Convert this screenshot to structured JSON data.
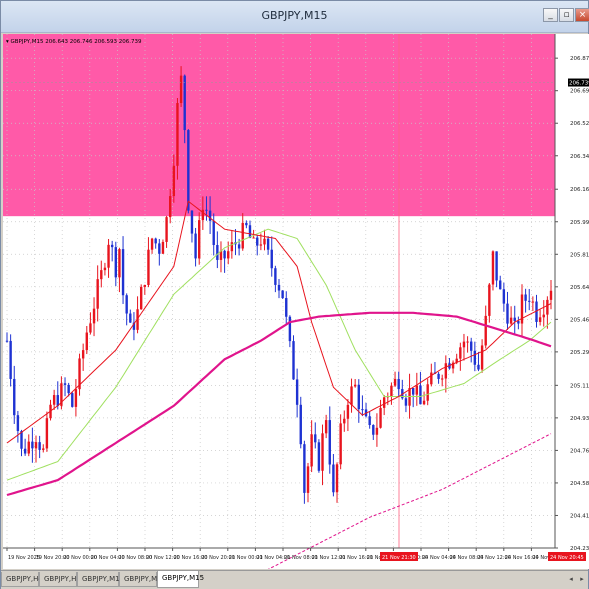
{
  "window": {
    "title": "GBPJPY,M15"
  },
  "info_line": "GBPJPY,M15  206.643 206.746 206.593 206.739",
  "current_price": "206.739",
  "price_axis": [
    "206.870",
    "206.695",
    "206.520",
    "206.345",
    "206.165",
    "205.990",
    "205.815",
    "205.640",
    "205.465",
    "205.290",
    "205.110",
    "204.935",
    "204.760",
    "204.585",
    "204.410",
    "204.235"
  ],
  "time_axis": [
    "19 Nov 2025",
    "19 Nov 20:00",
    "20 Nov 00:00",
    "20 Nov 04:00",
    "20 Nov 08:00",
    "20 Nov 12:00",
    "20 Nov 16:00",
    "20 Nov 20:00",
    "21 Nov 00:00",
    "21 Nov 04:00",
    "21 Nov 08:00",
    "21 Nov 12:00",
    "21 Nov 16:00",
    "21 Nov 20:00",
    "24 Nov 00:00",
    "24 Nov 04:00",
    "24 Nov 08:00",
    "24 Nov 12:00",
    "24 Nov 16:00",
    "24 Nov 20:00"
  ],
  "crosshair_time": "21 Nov 21:30",
  "cursor_time": "24 Nov 20:45",
  "tabs": [
    "GBPJPY,H4",
    "GBPJPY,H1",
    "GBPJPY,M15",
    "GBPJPY,M5",
    "GBPJPY,M15"
  ],
  "active_tab": 4,
  "colors": {
    "zone": "#ff5aa8",
    "bull": "#e8141e",
    "bear": "#1e32d2",
    "ma_red": "#e8141e",
    "ma_green": "#a0e060",
    "ma_magenta": "#e0148c"
  },
  "chart_data": {
    "type": "candlestick",
    "symbol": "GBPJPY",
    "timeframe": "M15",
    "ylim": [
      204.235,
      207.0
    ],
    "zone": [
      206.02,
      207.0
    ],
    "close_path": [
      [
        0,
        205.35
      ],
      [
        2,
        205.0
      ],
      [
        4,
        204.75
      ],
      [
        6,
        204.8
      ],
      [
        8,
        204.85
      ],
      [
        10,
        204.75
      ],
      [
        12,
        205.0
      ],
      [
        14,
        205.05
      ],
      [
        16,
        205.1
      ],
      [
        18,
        205.0
      ],
      [
        20,
        205.2
      ],
      [
        22,
        205.4
      ],
      [
        24,
        205.55
      ],
      [
        26,
        205.7
      ],
      [
        28,
        205.9
      ],
      [
        30,
        205.75
      ],
      [
        31,
        205.85
      ],
      [
        32,
        205.6
      ],
      [
        34,
        205.4
      ],
      [
        36,
        205.5
      ],
      [
        38,
        205.7
      ],
      [
        40,
        205.9
      ],
      [
        42,
        205.85
      ],
      [
        44,
        206.0
      ],
      [
        46,
        206.35
      ],
      [
        47,
        206.6
      ],
      [
        48,
        206.75
      ],
      [
        49,
        206.5
      ],
      [
        50,
        206.1
      ],
      [
        52,
        205.8
      ],
      [
        54,
        206.1
      ],
      [
        56,
        206.0
      ],
      [
        58,
        205.75
      ],
      [
        60,
        205.8
      ],
      [
        62,
        205.85
      ],
      [
        64,
        205.9
      ],
      [
        66,
        205.95
      ],
      [
        68,
        205.85
      ],
      [
        70,
        205.9
      ],
      [
        72,
        205.8
      ],
      [
        74,
        205.7
      ],
      [
        76,
        205.6
      ],
      [
        78,
        205.3
      ],
      [
        80,
        205.05
      ],
      [
        81,
        204.85
      ],
      [
        82,
        204.55
      ],
      [
        84,
        204.8
      ],
      [
        86,
        204.7
      ],
      [
        88,
        204.95
      ],
      [
        90,
        204.5
      ],
      [
        92,
        204.85
      ],
      [
        94,
        205.05
      ],
      [
        96,
        205.1
      ],
      [
        98,
        204.95
      ],
      [
        100,
        204.85
      ],
      [
        102,
        204.9
      ],
      [
        104,
        205.05
      ],
      [
        106,
        205.1
      ],
      [
        108,
        205.15
      ],
      [
        110,
        205.05
      ],
      [
        112,
        205.1
      ],
      [
        114,
        205.0
      ],
      [
        116,
        205.1
      ],
      [
        118,
        205.15
      ],
      [
        120,
        205.2
      ],
      [
        122,
        205.25
      ],
      [
        124,
        205.3
      ],
      [
        126,
        205.35
      ],
      [
        128,
        205.3
      ],
      [
        130,
        205.2
      ],
      [
        132,
        205.45
      ],
      [
        134,
        205.8
      ],
      [
        136,
        205.6
      ],
      [
        138,
        205.5
      ],
      [
        140,
        205.4
      ],
      [
        142,
        205.55
      ],
      [
        144,
        205.6
      ],
      [
        146,
        205.5
      ],
      [
        148,
        205.55
      ],
      [
        150,
        205.65
      ]
    ],
    "ma_red": [
      [
        0,
        204.8
      ],
      [
        14,
        205.0
      ],
      [
        30,
        205.3
      ],
      [
        46,
        205.75
      ],
      [
        50,
        206.1
      ],
      [
        60,
        205.95
      ],
      [
        74,
        205.9
      ],
      [
        80,
        205.75
      ],
      [
        84,
        205.45
      ],
      [
        90,
        205.1
      ],
      [
        98,
        204.95
      ],
      [
        108,
        205.05
      ],
      [
        120,
        205.2
      ],
      [
        132,
        205.3
      ],
      [
        140,
        205.45
      ],
      [
        150,
        205.55
      ]
    ],
    "ma_green": [
      [
        0,
        204.6
      ],
      [
        14,
        204.7
      ],
      [
        30,
        205.1
      ],
      [
        46,
        205.6
      ],
      [
        60,
        205.85
      ],
      [
        72,
        205.95
      ],
      [
        80,
        205.9
      ],
      [
        88,
        205.65
      ],
      [
        96,
        205.3
      ],
      [
        104,
        205.05
      ],
      [
        114,
        205.05
      ],
      [
        126,
        205.12
      ],
      [
        136,
        205.25
      ],
      [
        144,
        205.35
      ],
      [
        150,
        205.45
      ]
    ],
    "ma_magenta": [
      [
        0,
        204.52
      ],
      [
        14,
        204.6
      ],
      [
        30,
        204.8
      ],
      [
        46,
        205.0
      ],
      [
        60,
        205.25
      ],
      [
        70,
        205.35
      ],
      [
        78,
        205.45
      ],
      [
        86,
        205.48
      ],
      [
        100,
        205.5
      ],
      [
        112,
        205.5
      ],
      [
        124,
        205.48
      ],
      [
        134,
        205.42
      ],
      [
        144,
        205.36
      ],
      [
        150,
        205.32
      ]
    ],
    "ma_dashed": [
      [
        0,
        204.0
      ],
      [
        60,
        204.0
      ],
      [
        80,
        204.2
      ],
      [
        100,
        204.4
      ],
      [
        120,
        204.55
      ],
      [
        150,
        204.85
      ]
    ]
  }
}
